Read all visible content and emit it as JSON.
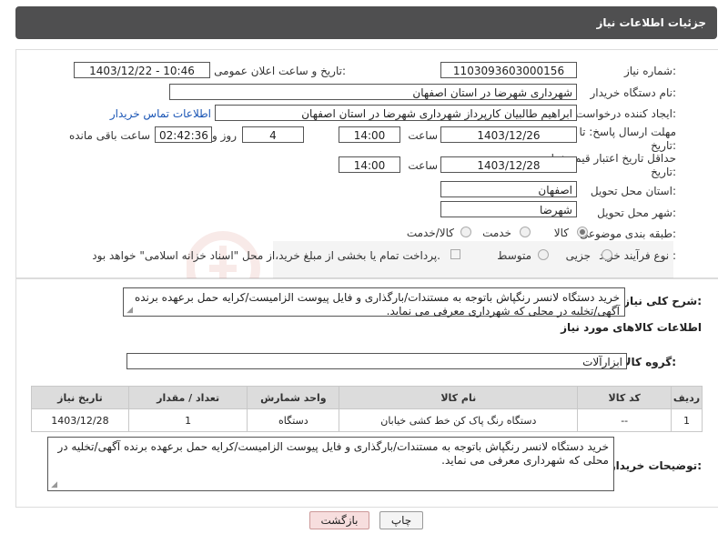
{
  "header": {
    "title": "جزئیات اطلاعات نیاز"
  },
  "form": {
    "need_number_label": "شماره نیاز:",
    "need_number": "1103093603000156",
    "announce_label": "تاریخ و ساعت اعلان عمومی:",
    "announce_value": "1403/12/22 - 10:46",
    "buyer_org_label": "نام دستگاه خریدار:",
    "buyer_org": "شهرداری شهرضا در استان اصفهان",
    "creator_label": "ایجاد کننده درخواست:",
    "creator": "ابراهیم طالبیان کارپرداز شهرداری شهرضا در استان اصفهان",
    "contact_link": "اطلاعات تماس خریدار",
    "deadline_label_1": "مهلت ارسال پاسخ: تا",
    "deadline_label_2": "تاریخ:",
    "deadline_date": "1403/12/26",
    "time_label": "ساعت",
    "deadline_time": "14:00",
    "days_value": "4",
    "days_label": "روز و",
    "remaining_time": "02:42:36",
    "remaining_label": "ساعت باقی مانده",
    "validity_label_1": "حداقل تاریخ اعتبار قیمت: تا",
    "validity_label_2": "تاریخ:",
    "validity_date": "1403/12/28",
    "validity_time": "14:00",
    "province_label": "استان محل تحویل:",
    "province": "اصفهان",
    "city_label": "شهر محل تحویل:",
    "city": "شهرضا",
    "category_label": "طبقه بندی موضوعی:",
    "category_options": [
      "کالا",
      "خدمت",
      "کالا/خدمت"
    ],
    "process_label": "نوع فرآیند خرید :",
    "process_options": [
      "جزیی",
      "متوسط"
    ],
    "payment_text": "پرداخت تمام یا بخشی از مبلغ خرید،از محل \"اسناد خزانه اسلامی\" خواهد بود."
  },
  "description": {
    "label": "شرح کلی نیاز:",
    "text": "خرید دستگاه لانسر رنگپاش باتوجه به مستندات/بارگذاری و فایل پیوست الزامیست/کرایه حمل برعهده برنده آگهی/تخلیه در محلی که شهرداری معرفی می نماید."
  },
  "goods_section": {
    "title": "اطلاعات کالاهای مورد نیاز",
    "group_label": "گروه کالا:",
    "group_value": "ابزارآلات"
  },
  "table": {
    "headers": [
      "ردیف",
      "کد کالا",
      "نام کالا",
      "واحد شمارش",
      "تعداد / مقدار",
      "تاریخ نیاز"
    ],
    "rows": [
      [
        "1",
        "--",
        "دستگاه رنگ پاک کن خط کشی خیابان",
        "دستگاه",
        "1",
        "1403/12/28"
      ]
    ]
  },
  "buyer_notes": {
    "label": "توضیحات خریدار:",
    "text": "خرید دستگاه لانسر رنگپاش باتوجه به مستندات/بارگذاری و فایل پیوست الزامیست/کرایه حمل برعهده برنده آگهی/تخلیه در محلی که شهرداری معرفی می نماید."
  },
  "buttons": {
    "print": "چاپ",
    "back": "بازگشت"
  },
  "colors": {
    "header_bg": "#4f4f50",
    "back_button_bg": "#f7dede",
    "link": "#1a55b5"
  }
}
